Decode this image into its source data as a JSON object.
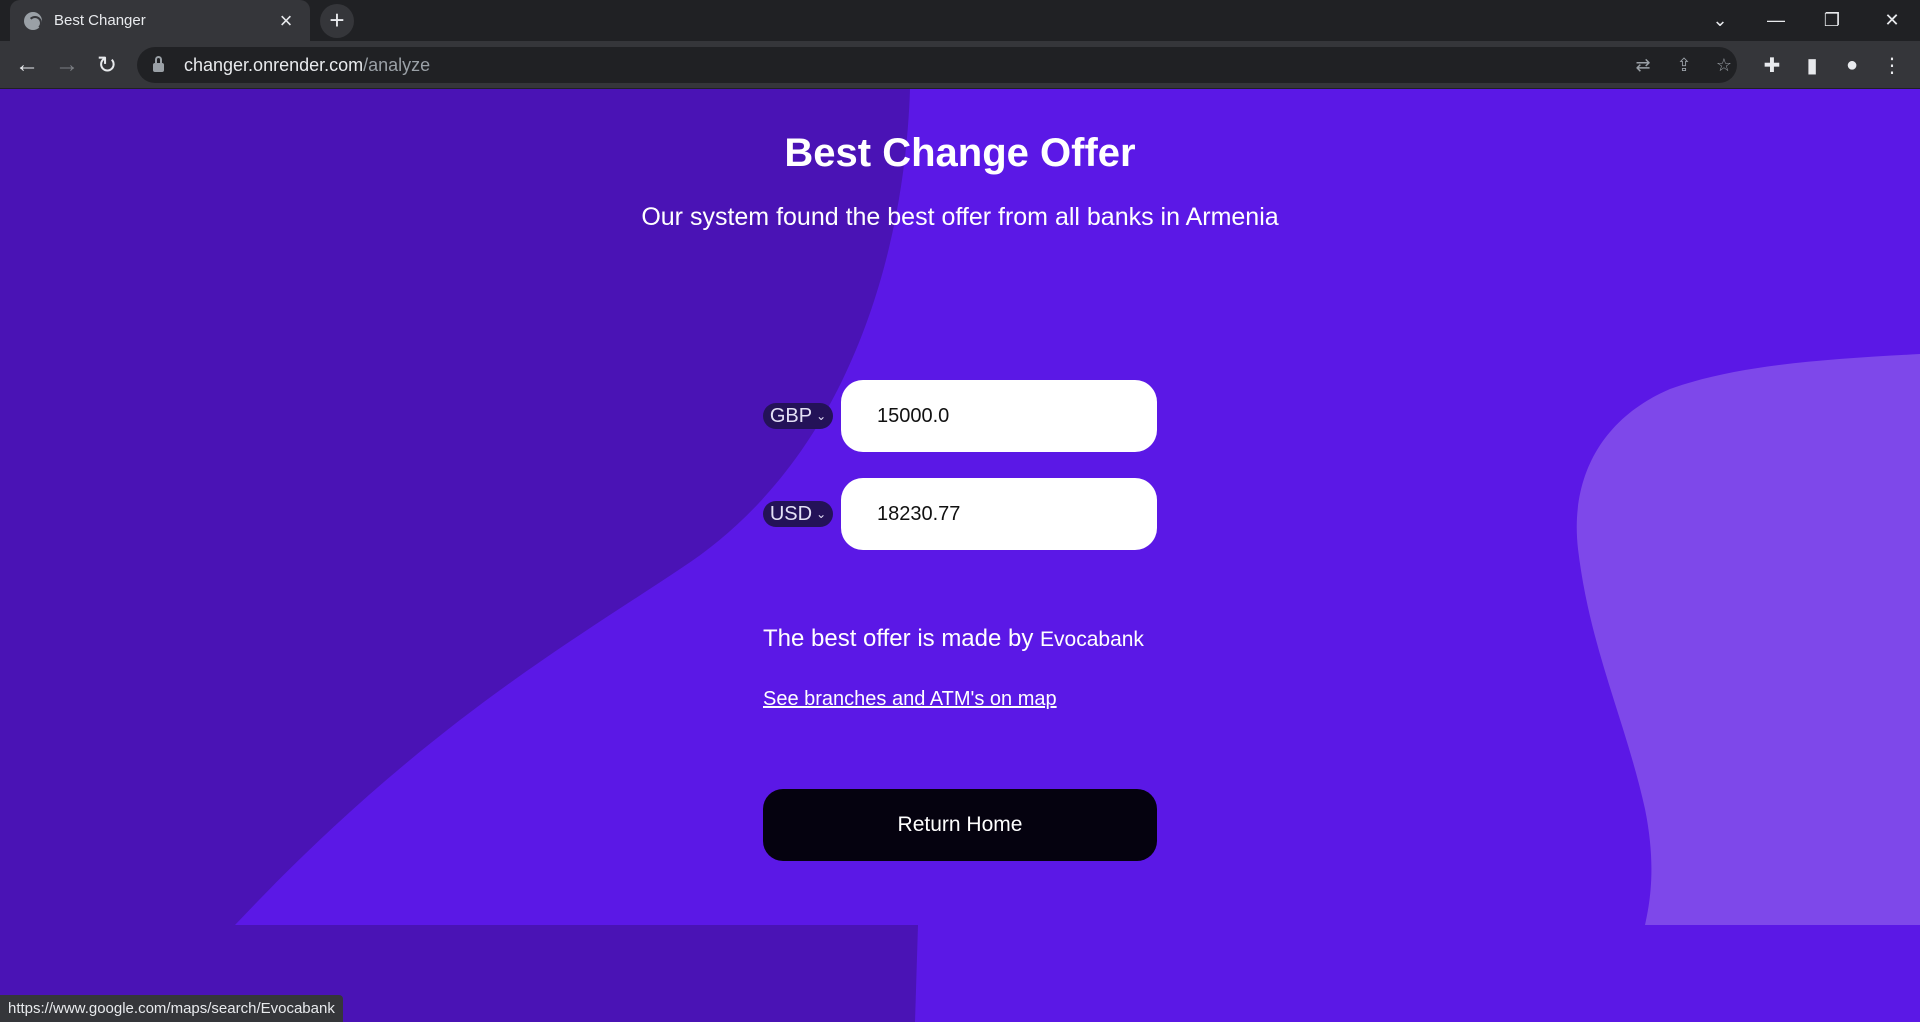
{
  "browser": {
    "tab_title": "Best Changer",
    "tab_close": "×",
    "new_tab": "+",
    "url_host": "changer.onrender.com",
    "url_path": "/analyze",
    "window_controls": {
      "tabsearch": "⌄",
      "minimize": "—",
      "restore": "❐",
      "close": "✕"
    },
    "nav": {
      "back": "←",
      "forward": "→",
      "reload": "↻"
    },
    "toolbar_icons": {
      "translate": "⇄",
      "share": "⇪",
      "bookmark": "☆",
      "extensions": "✚",
      "sidepanel": "▮",
      "profile": "●",
      "menu": "⋮"
    }
  },
  "page": {
    "title": "Best Change Offer",
    "subtitle": "Our system found the best offer from all banks in Armenia",
    "from": {
      "currency": "GBP",
      "amount": "15000.0"
    },
    "to": {
      "currency": "USD",
      "amount": "18230.77"
    },
    "chevron": "⌄",
    "offer_prefix": "The best offer is made by ",
    "offer_bank": "Evocabank",
    "map_link": "See branches and ATM's on map",
    "return_button": "Return Home"
  },
  "status_url": "https://www.google.com/maps/search/Evocabank",
  "colors": {
    "background": "#5b18e6",
    "shape_dark": "#4a13b5",
    "shape_light": "#7e48ea",
    "button": "#05020f"
  }
}
